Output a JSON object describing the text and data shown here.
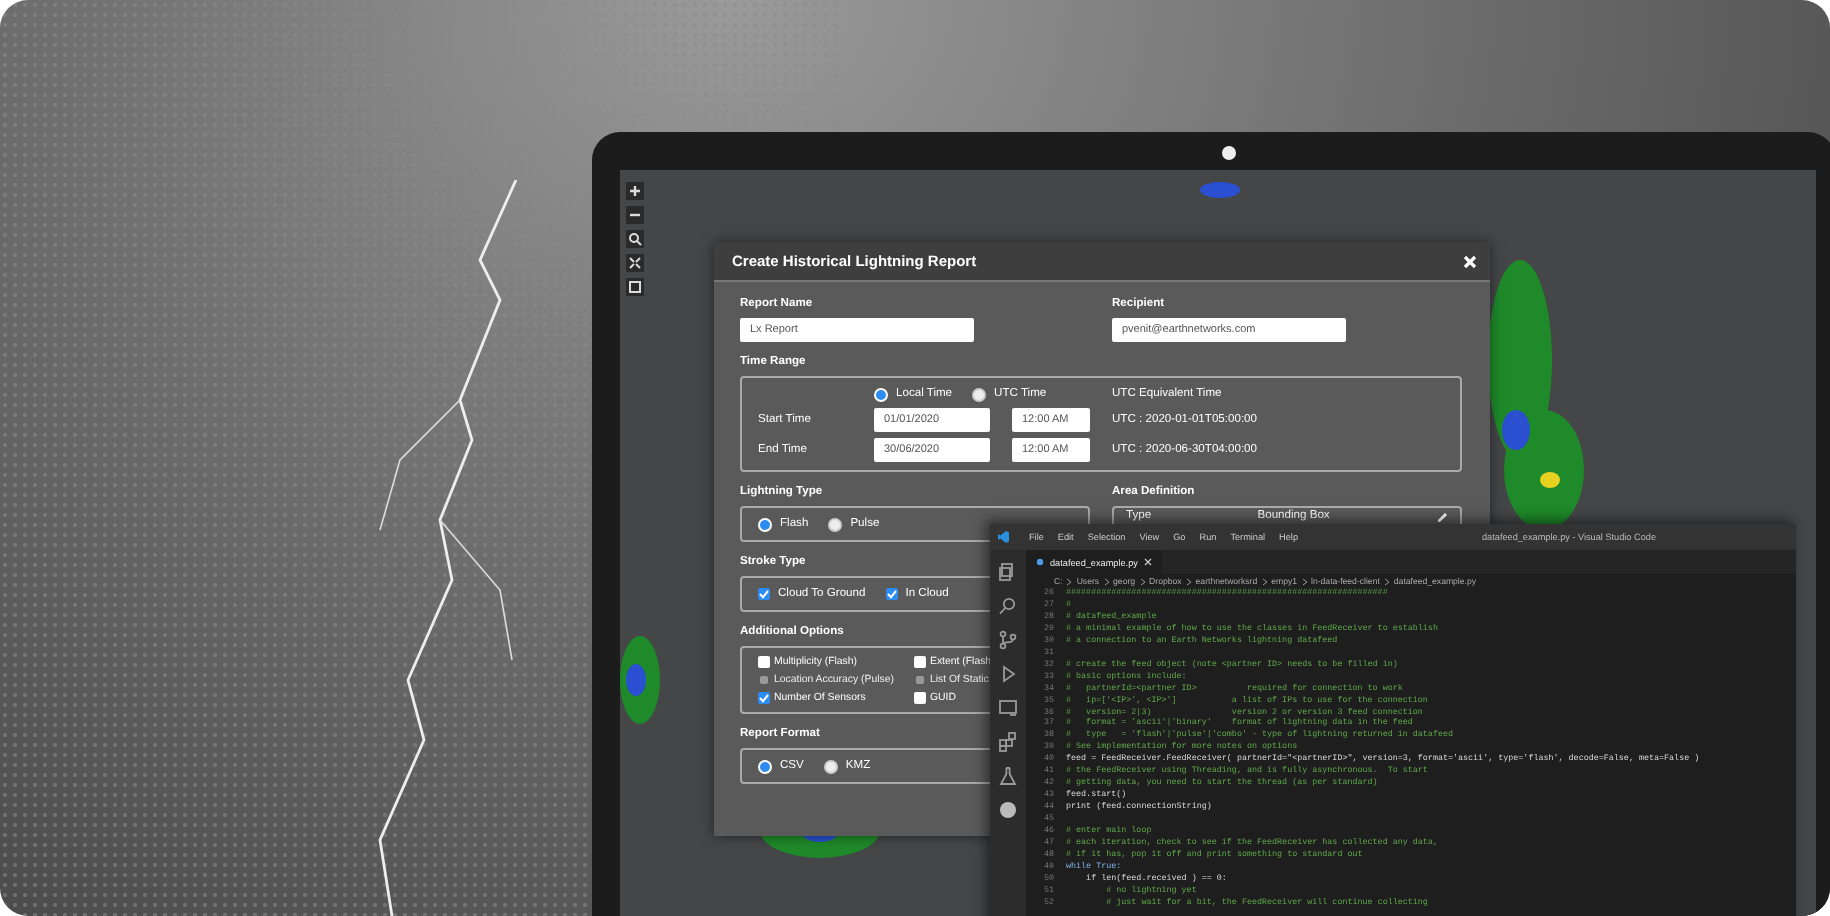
{
  "dialog": {
    "title": "Create Historical Lightning Report",
    "report_name": {
      "label": "Report Name",
      "value": "Lx Report"
    },
    "recipient": {
      "label": "Recipient",
      "value": "pvenit@earthnetworks.com"
    },
    "time_range": {
      "label": "Time Range",
      "modes": [
        {
          "label": "Local Time",
          "selected": true
        },
        {
          "label": "UTC Time",
          "selected": false
        }
      ],
      "equivalent_heading": "UTC Equivalent Time",
      "rows": [
        {
          "label": "Start Time",
          "date": "01/01/2020",
          "time": "12:00 AM",
          "utc": "UTC : 2020-01-01T05:00:00"
        },
        {
          "label": "End Time",
          "date": "30/06/2020",
          "time": "12:00 AM",
          "utc": "UTC : 2020-06-30T04:00:00"
        }
      ]
    },
    "lightning_type": {
      "label": "Lightning Type",
      "options": [
        {
          "label": "Flash",
          "selected": true
        },
        {
          "label": "Pulse",
          "selected": false
        }
      ]
    },
    "stroke_type": {
      "label": "Stroke Type",
      "options": [
        {
          "label": "Cloud To Ground",
          "checked": true,
          "disabled": false
        },
        {
          "label": "In Cloud",
          "checked": true,
          "disabled": false
        }
      ]
    },
    "additional_options": {
      "label": "Additional Options",
      "options": [
        {
          "label": "Multiplicity (Flash)",
          "checked": false,
          "disabled": false
        },
        {
          "label": "Extent (Flash",
          "checked": false,
          "disabled": false
        },
        {
          "label": "Location Accuracy (Pulse)",
          "checked": false,
          "disabled": true
        },
        {
          "label": "List Of Static",
          "checked": false,
          "disabled": true
        },
        {
          "label": "Number Of Sensors",
          "checked": true,
          "disabled": false
        },
        {
          "label": "GUID",
          "checked": false,
          "disabled": false
        }
      ]
    },
    "report_format": {
      "label": "Report Format",
      "options": [
        {
          "label": "CSV",
          "selected": true
        },
        {
          "label": "KMZ",
          "selected": false
        }
      ]
    },
    "area_definition": {
      "label": "Area Definition",
      "type_label": "Type",
      "type_value": "Bounding Box"
    }
  },
  "editor": {
    "menu": [
      "File",
      "Edit",
      "Selection",
      "View",
      "Go",
      "Run",
      "Terminal",
      "Help"
    ],
    "title": "datafeed_example.py - Visual Studio Code",
    "tabs": [
      {
        "label": "datafeed_example.py",
        "selected": true
      }
    ],
    "breadcrumb": [
      "C:",
      "Users",
      "georg",
      "Dropbox",
      "earthnetworksrd",
      "empy1",
      "ln-data-feed-client",
      "datafeed_example.py"
    ],
    "lines": [
      {
        "number": "26",
        "kind": "comment",
        "text": "################################################################"
      },
      {
        "number": "27",
        "kind": "comment",
        "text": "#"
      },
      {
        "number": "28",
        "kind": "comment",
        "text": "# datafeed_example"
      },
      {
        "number": "29",
        "kind": "comment",
        "text": "# a minimal example of how to use the classes in FeedReceiver to establish"
      },
      {
        "number": "30",
        "kind": "comment",
        "text": "# a connection to an Earth Networks lightning datafeed"
      },
      {
        "number": "31",
        "kind": "blank"
      },
      {
        "number": "32",
        "kind": "comment",
        "text": "# create the feed object (note <partner ID> needs to be filled in)"
      },
      {
        "number": "33",
        "kind": "comment",
        "text": "# basic options include:"
      },
      {
        "number": "34",
        "kind": "comment",
        "text": "#   partnerId=<partner ID>          required for connection to work"
      },
      {
        "number": "35",
        "kind": "comment",
        "text": "#   ip=['<IP>', <IP>']           a list of IPs to use for the connection"
      },
      {
        "number": "36",
        "kind": "comment",
        "text": "#   version= 2|3)                version 2 or version 3 feed connection"
      },
      {
        "number": "37",
        "kind": "comment",
        "text": "#   format = 'ascii'|'binary'    format of lightning data in the feed"
      },
      {
        "number": "38",
        "kind": "comment",
        "text": "#   type   = 'flash'|'pulse'|'combo' - type of lightning returned in datafeed"
      },
      {
        "number": "39",
        "kind": "comment",
        "text": "# See implementation for more notes on options"
      },
      {
        "number": "40",
        "kind": "code",
        "text": "feed = FeedReceiver.FeedReceiver( partnerId=\"<partnerID>\", version=3, format='ascii', type='flash', decode=False, meta=False )"
      },
      {
        "number": "41",
        "kind": "comment",
        "text": "# the FeedReceiver using Threading, and is fully asynchronous.  To start"
      },
      {
        "number": "42",
        "kind": "comment",
        "text": "# getting data, you need to start the thread (as per standard)"
      },
      {
        "number": "43",
        "kind": "code",
        "text": "feed.start()"
      },
      {
        "number": "44",
        "kind": "code",
        "text": "print (feed.connectionString)"
      },
      {
        "number": "45",
        "kind": "blank"
      },
      {
        "number": "46",
        "kind": "comment",
        "text": "# enter main loop"
      },
      {
        "number": "47",
        "kind": "comment",
        "text": "# each iteration, check to see if the FeedReceiver has collected any data,"
      },
      {
        "number": "48",
        "kind": "comment",
        "text": "# if it has, pop it off and print something to standard out"
      },
      {
        "number": "49",
        "kind": "keyword",
        "text": "while True:"
      },
      {
        "number": "50",
        "kind": "code",
        "text": "    if len(feed.received ) == 0:"
      },
      {
        "number": "51",
        "kind": "comment",
        "text": "        # no lightning yet"
      },
      {
        "number": "52",
        "kind": "comment",
        "text": "        # just wait for a bit, the FeedReceiver will continue collecting"
      }
    ]
  }
}
